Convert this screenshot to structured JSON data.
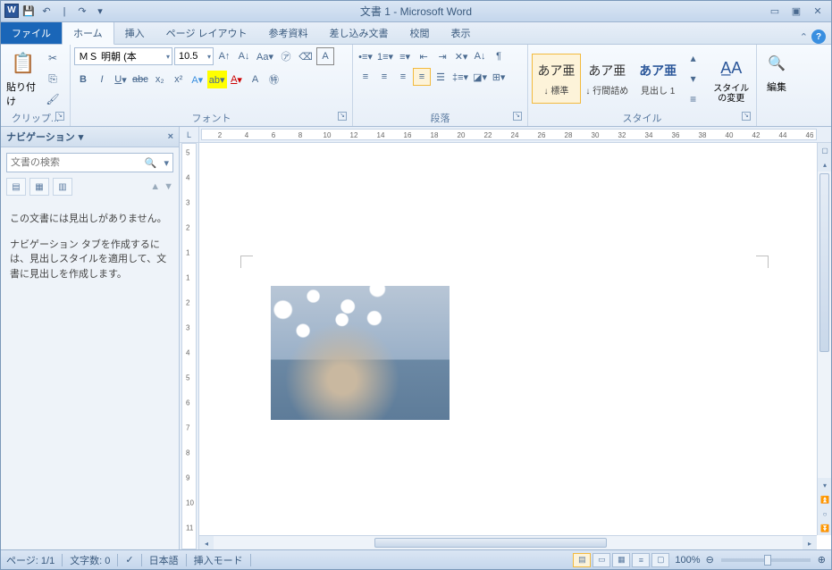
{
  "title": "文書 1 - Microsoft Word",
  "qat": {
    "save": "💾",
    "undo": "↶",
    "redo": "↷"
  },
  "tabs": {
    "file": "ファイル",
    "home": "ホーム",
    "insert": "挿入",
    "layout": "ページ レイアウト",
    "ref": "参考資料",
    "mail": "差し込み文書",
    "review": "校閲",
    "view": "表示"
  },
  "ribbon": {
    "clipboard": {
      "label": "クリップ...",
      "paste": "貼り付け"
    },
    "font": {
      "label": "フォント",
      "name": "ＭＳ 明朝 (本",
      "size": "10.5"
    },
    "paragraph": {
      "label": "段落"
    },
    "styles": {
      "label": "スタイル",
      "items": [
        {
          "prev": "あア亜",
          "name": "↓ 標準"
        },
        {
          "prev": "あア亜",
          "name": "↓ 行間詰め"
        },
        {
          "prev": "あア亜",
          "name": "見出し 1"
        }
      ],
      "change": "スタイルの変更"
    },
    "edit": {
      "label": "編集"
    }
  },
  "nav": {
    "title": "ナビゲーション",
    "search_ph": "文書の検索",
    "msg1": "この文書には見出しがありません。",
    "msg2": "ナビゲーション タブを作成するには、見出しスタイルを適用して、文書に見出しを作成します。"
  },
  "ruler_h": [
    2,
    4,
    6,
    8,
    10,
    12,
    14,
    16,
    18,
    20,
    22,
    24,
    26,
    28,
    30,
    32,
    34,
    36,
    38,
    40,
    42,
    44,
    46
  ],
  "ruler_v": [
    5,
    4,
    3,
    2,
    1,
    1,
    2,
    3,
    4,
    5,
    6,
    7,
    8,
    9,
    10,
    11
  ],
  "status": {
    "page": "ページ: 1/1",
    "words": "文字数: 0",
    "lang": "日本語",
    "mode": "挿入モード",
    "zoom": "100%"
  }
}
